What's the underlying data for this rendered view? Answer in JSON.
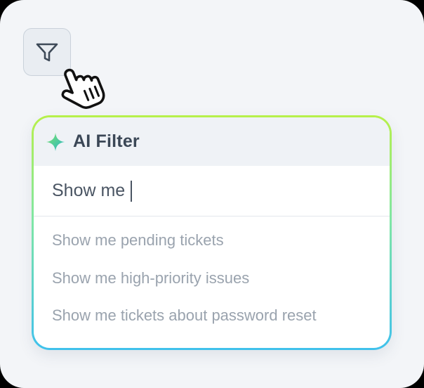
{
  "filter_button": {
    "icon": "funnel-icon"
  },
  "cursor": {
    "icon": "hand-pointer-icon"
  },
  "ai_filter": {
    "title": "AI Filter",
    "icon": "sparkle-icon",
    "query_value": "Show me",
    "suggestions": [
      "Show me pending tickets",
      "Show me high-priority issues",
      "Show me tickets about password reset"
    ]
  },
  "colors": {
    "background": "#f3f5f8",
    "border_gradient_top": "#b7f04a",
    "border_gradient_bottom": "#3fc1ec",
    "header_bg": "#eff2f6",
    "title_text": "#3b4756",
    "suggestion_text": "#9aa3ae"
  }
}
